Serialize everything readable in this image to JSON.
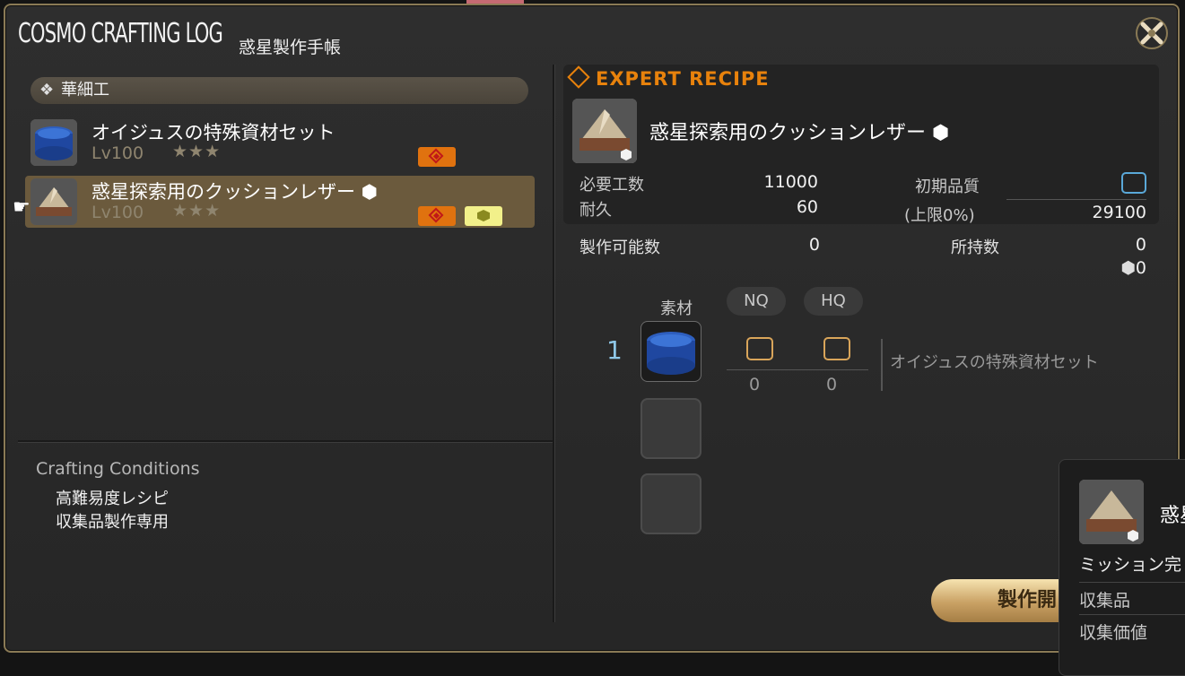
{
  "window": {
    "title": "COSMO CRAFTING LOG",
    "subtitle": "惑星製作手帳"
  },
  "left": {
    "category": "華細工",
    "items": [
      {
        "name": "オイジュスの特殊資材セット",
        "level": "Lv100",
        "stars": "★★★",
        "icon": "blue-material-set-icon"
      },
      {
        "name": "惑星探索用のクッションレザー",
        "level": "Lv100",
        "stars": "★★★",
        "icon": "leather-icon"
      }
    ],
    "conditions": {
      "title": "Crafting Conditions",
      "lines": [
        "高難易度レシピ",
        "収集品製作専用"
      ]
    }
  },
  "recipe": {
    "header": "EXPERT RECIPE",
    "name": "惑星探索用のクッションレザー",
    "stats": {
      "progress_label": "必要工数",
      "progress_value": "11000",
      "durability_label": "耐久",
      "durability_value": "60",
      "quality_label": "初期品質",
      "quality_cap_label": "(上限0%)",
      "quality_max": "29100",
      "craftable_label": "製作可能数",
      "craftable_value": "0",
      "owned_label": "所持数",
      "owned_value": "0",
      "owned_collectable_value": "0"
    },
    "materials": {
      "header": "素材",
      "nq": "NQ",
      "hq": "HQ",
      "rows": [
        {
          "qty": "1",
          "nq": "0",
          "hq": "0",
          "name": "オイジュスの特殊資材セット"
        }
      ]
    },
    "craft_button": "製作開"
  },
  "tooltip": {
    "name": "惑星",
    "lines": [
      "ミッション完",
      "収集品",
      "収集価値"
    ]
  },
  "colors": {
    "expert": "#e8820c",
    "button": "#c9a164"
  }
}
